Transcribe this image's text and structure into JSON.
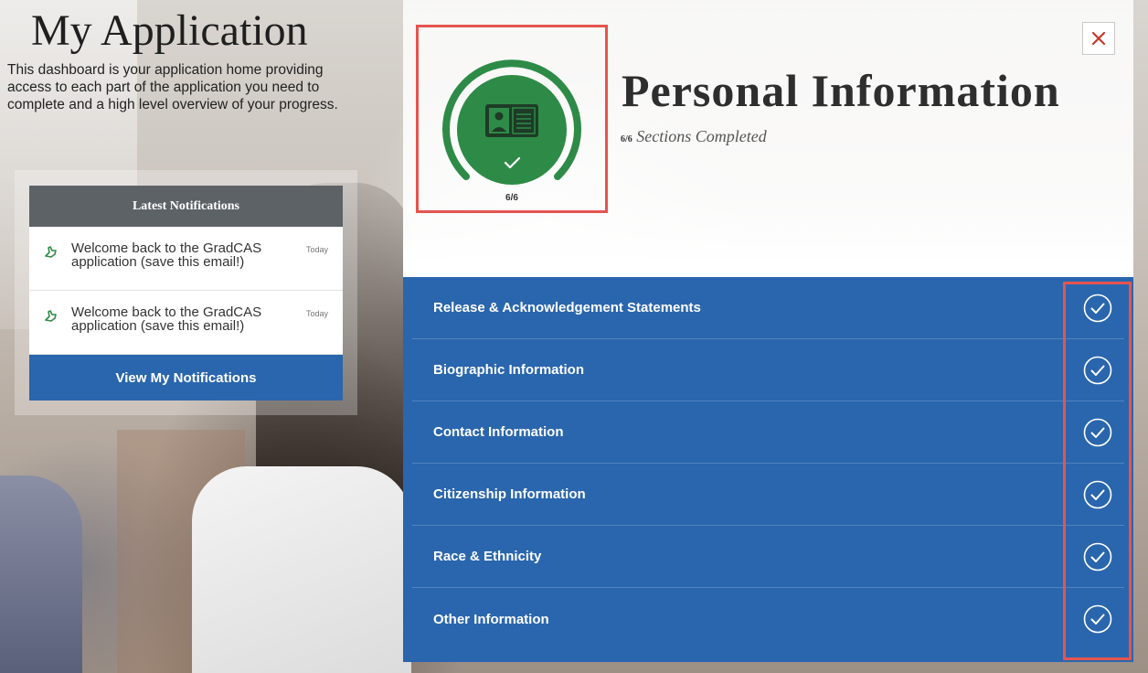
{
  "left": {
    "title": "My Application",
    "description": "This dashboard is your application home providing access to each part of the application you need to complete and a high level overview of your progress.",
    "notifications": {
      "header": "Latest Notifications",
      "items": [
        {
          "text": "Welcome back to the GradCAS application (save this email!)",
          "date": "Today",
          "icon": "hand-point-icon"
        },
        {
          "text": "Welcome back to the GradCAS application (save this email!)",
          "date": "Today",
          "icon": "hand-point-icon"
        }
      ],
      "button_label": "View My Notifications"
    }
  },
  "panel": {
    "title": "Personal Information",
    "progress_count": "6/6",
    "progress_text": "Sections Completed",
    "progress_ring_label": "6/6",
    "progress_fraction": 1.0,
    "icon": "id-card-icon",
    "close_icon": "close-icon",
    "sections": [
      {
        "label": "Release & Acknowledgement Statements",
        "status": "complete"
      },
      {
        "label": "Biographic Information",
        "status": "complete"
      },
      {
        "label": "Contact Information",
        "status": "complete"
      },
      {
        "label": "Citizenship Information",
        "status": "complete"
      },
      {
        "label": "Race & Ethnicity",
        "status": "complete"
      },
      {
        "label": "Other Information",
        "status": "complete"
      }
    ]
  },
  "colors": {
    "accent_blue": "#2a66ad",
    "progress_green": "#2e8b47",
    "highlight_red": "#e5544f",
    "header_gray": "#5d6267"
  }
}
